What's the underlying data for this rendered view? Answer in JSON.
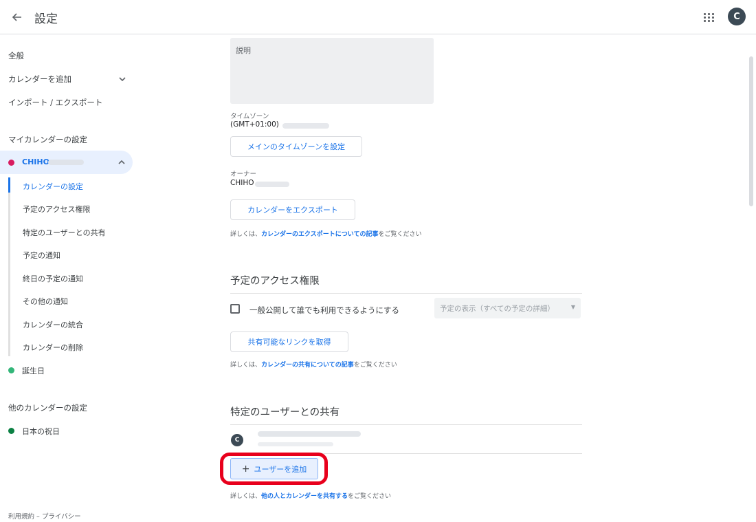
{
  "header": {
    "title": "設定",
    "avatar_letter": "C"
  },
  "sidebar": {
    "general": "全般",
    "add_calendar": "カレンダーを追加",
    "import_export": "インポート / エクスポート",
    "my_calendars_title": "マイカレンダーの設定",
    "active_calendar_name": "CHIHO",
    "sub_items": [
      "カレンダーの設定",
      "予定のアクセス権限",
      "特定のユーザーとの共有",
      "予定の通知",
      "終日の予定の通知",
      "その他の通知",
      "カレンダーの統合",
      "カレンダーの削除"
    ],
    "birthday": "誕生日",
    "other_calendars_title": "他のカレンダーの設定",
    "japan_holidays": "日本の祝日",
    "footer_terms": "利用規約",
    "footer_sep": " – ",
    "footer_privacy": "プライバシー"
  },
  "colors": {
    "accent": "#1a73e8",
    "calendar_dot": "#d81b60",
    "birthday_dot": "#33b679",
    "holiday_dot": "#0b8043",
    "highlight": "#e8001c"
  },
  "main": {
    "description_label": "説明",
    "timezone_label": "タイムゾーン",
    "timezone_value": "(GMT+01:00)",
    "set_main_timezone_button": "メインのタイムゾーンを設定",
    "owner_label": "オーナー",
    "owner_value": "CHIHO",
    "export_button": "カレンダーをエクスポート",
    "export_help_prefix": "詳しくは、",
    "export_help_link": "カレンダーのエクスポートについての記事",
    "export_help_suffix": "をご覧ください",
    "access_title": "予定のアクセス権限",
    "public_checkbox_label": "一般公開して誰でも利用できるようにする",
    "visibility_select": "予定の表示（すべての予定の詳細）",
    "share_link_button": "共有可能なリンクを取得",
    "share_help_prefix": "詳しくは、",
    "share_help_link": "カレンダーの共有についての記事",
    "share_help_suffix": "をご覧ください",
    "sharing_title": "特定のユーザーとの共有",
    "shared_user_avatar": "C",
    "add_user_button": "ユーザーを追加",
    "add_help_prefix": "詳しくは、",
    "add_help_link": "他の人とカレンダーを共有する",
    "add_help_suffix": "をご覧ください"
  }
}
